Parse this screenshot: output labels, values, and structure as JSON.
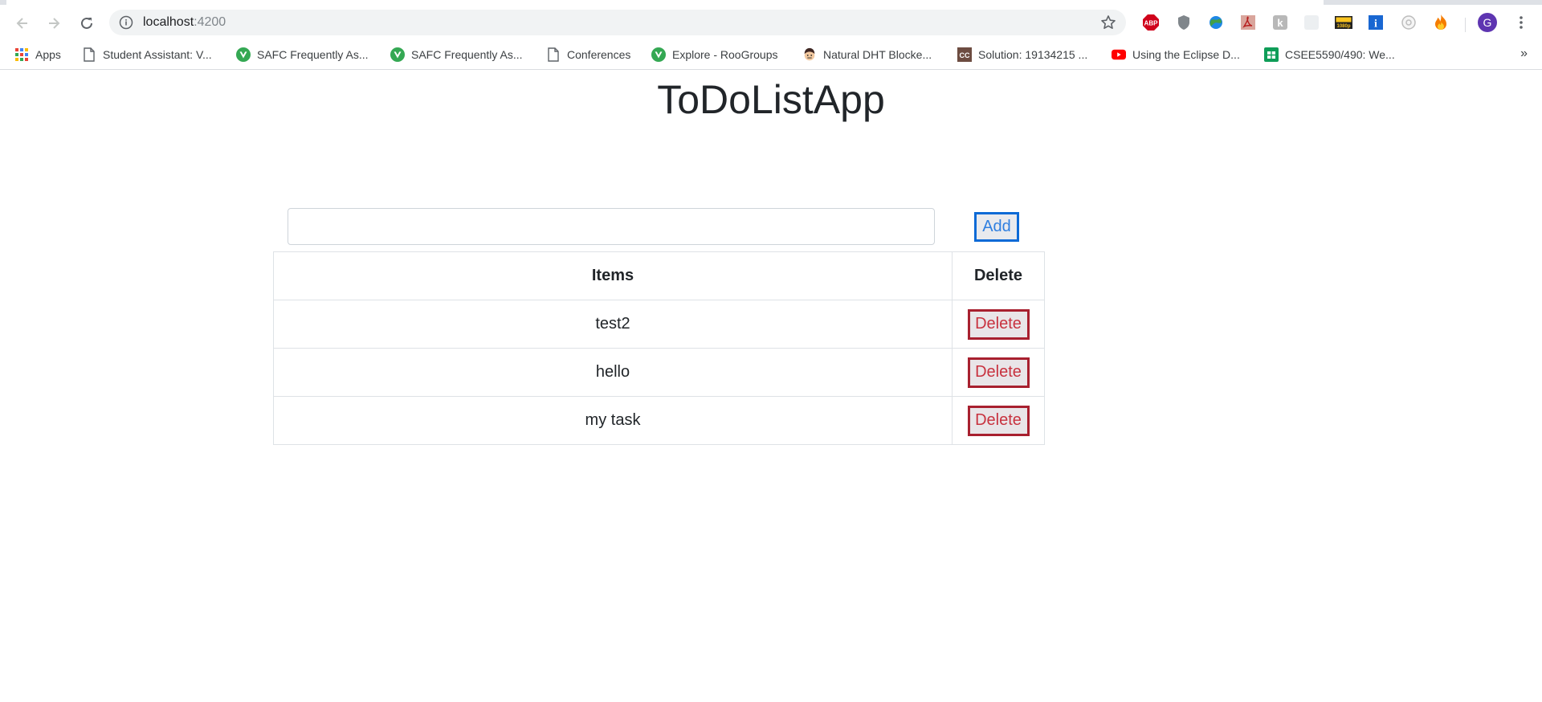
{
  "browser": {
    "url_host": "localhost",
    "url_port": ":4200",
    "icons": {
      "back": "back-arrow-icon",
      "forward": "forward-arrow-icon",
      "reload": "reload-icon",
      "info": "info-icon",
      "star": "star-icon"
    },
    "extensions": [
      {
        "name": "adblock-icon",
        "label": "ABP",
        "color": "#d0021b"
      },
      {
        "name": "shield-icon",
        "label": "",
        "color": "#80868b"
      },
      {
        "name": "globe-extension-icon",
        "label": "",
        "color": "#2e7d32"
      },
      {
        "name": "pdf-extension-icon",
        "label": "",
        "color": "#c0392b"
      },
      {
        "name": "k-extension-icon",
        "label": "k",
        "color": "#b0b0b0"
      },
      {
        "name": "blank-extension-icon",
        "label": "",
        "color": "#e8e8e8"
      },
      {
        "name": "hd-extension-icon",
        "label": "1080p",
        "color": "#222222"
      },
      {
        "name": "info-extension-icon",
        "label": "i",
        "color": "#1967d2"
      },
      {
        "name": "circle-extension-icon",
        "label": "",
        "color": "#c8c8c8"
      },
      {
        "name": "fire-extension-icon",
        "label": "",
        "color": "#f57c00"
      }
    ],
    "profile_initial": "G",
    "profile_color": "#5e35b1",
    "menu_icon": "kebab-menu-icon"
  },
  "bookmarks": {
    "items": [
      {
        "label": "Apps",
        "icon": "apps-grid-icon"
      },
      {
        "label": "Student Assistant: V...",
        "icon": "document-icon"
      },
      {
        "label": "SAFC Frequently As...",
        "icon": "vue-logo-icon"
      },
      {
        "label": "SAFC Frequently As...",
        "icon": "vue-logo-icon"
      },
      {
        "label": "Conferences",
        "icon": "document-icon"
      },
      {
        "label": "Explore - RooGroups",
        "icon": "vue-logo-icon"
      },
      {
        "label": "Natural DHT Blocke...",
        "icon": "face-icon"
      },
      {
        "label": "Solution: 19134215 ...",
        "icon": "cc-icon"
      },
      {
        "label": "Using the Eclipse D...",
        "icon": "youtube-icon"
      },
      {
        "label": "CSEE5590/490: We...",
        "icon": "sheets-icon"
      }
    ],
    "more": "»"
  },
  "app": {
    "title": "ToDoListApp",
    "input_value": "",
    "input_placeholder": "",
    "add_label": "Add",
    "table": {
      "headers": [
        "Items",
        "Delete"
      ],
      "rows": [
        {
          "item": "test2",
          "action": "Delete"
        },
        {
          "item": "hello",
          "action": "Delete"
        },
        {
          "item": "my task",
          "action": "Delete"
        }
      ]
    }
  }
}
